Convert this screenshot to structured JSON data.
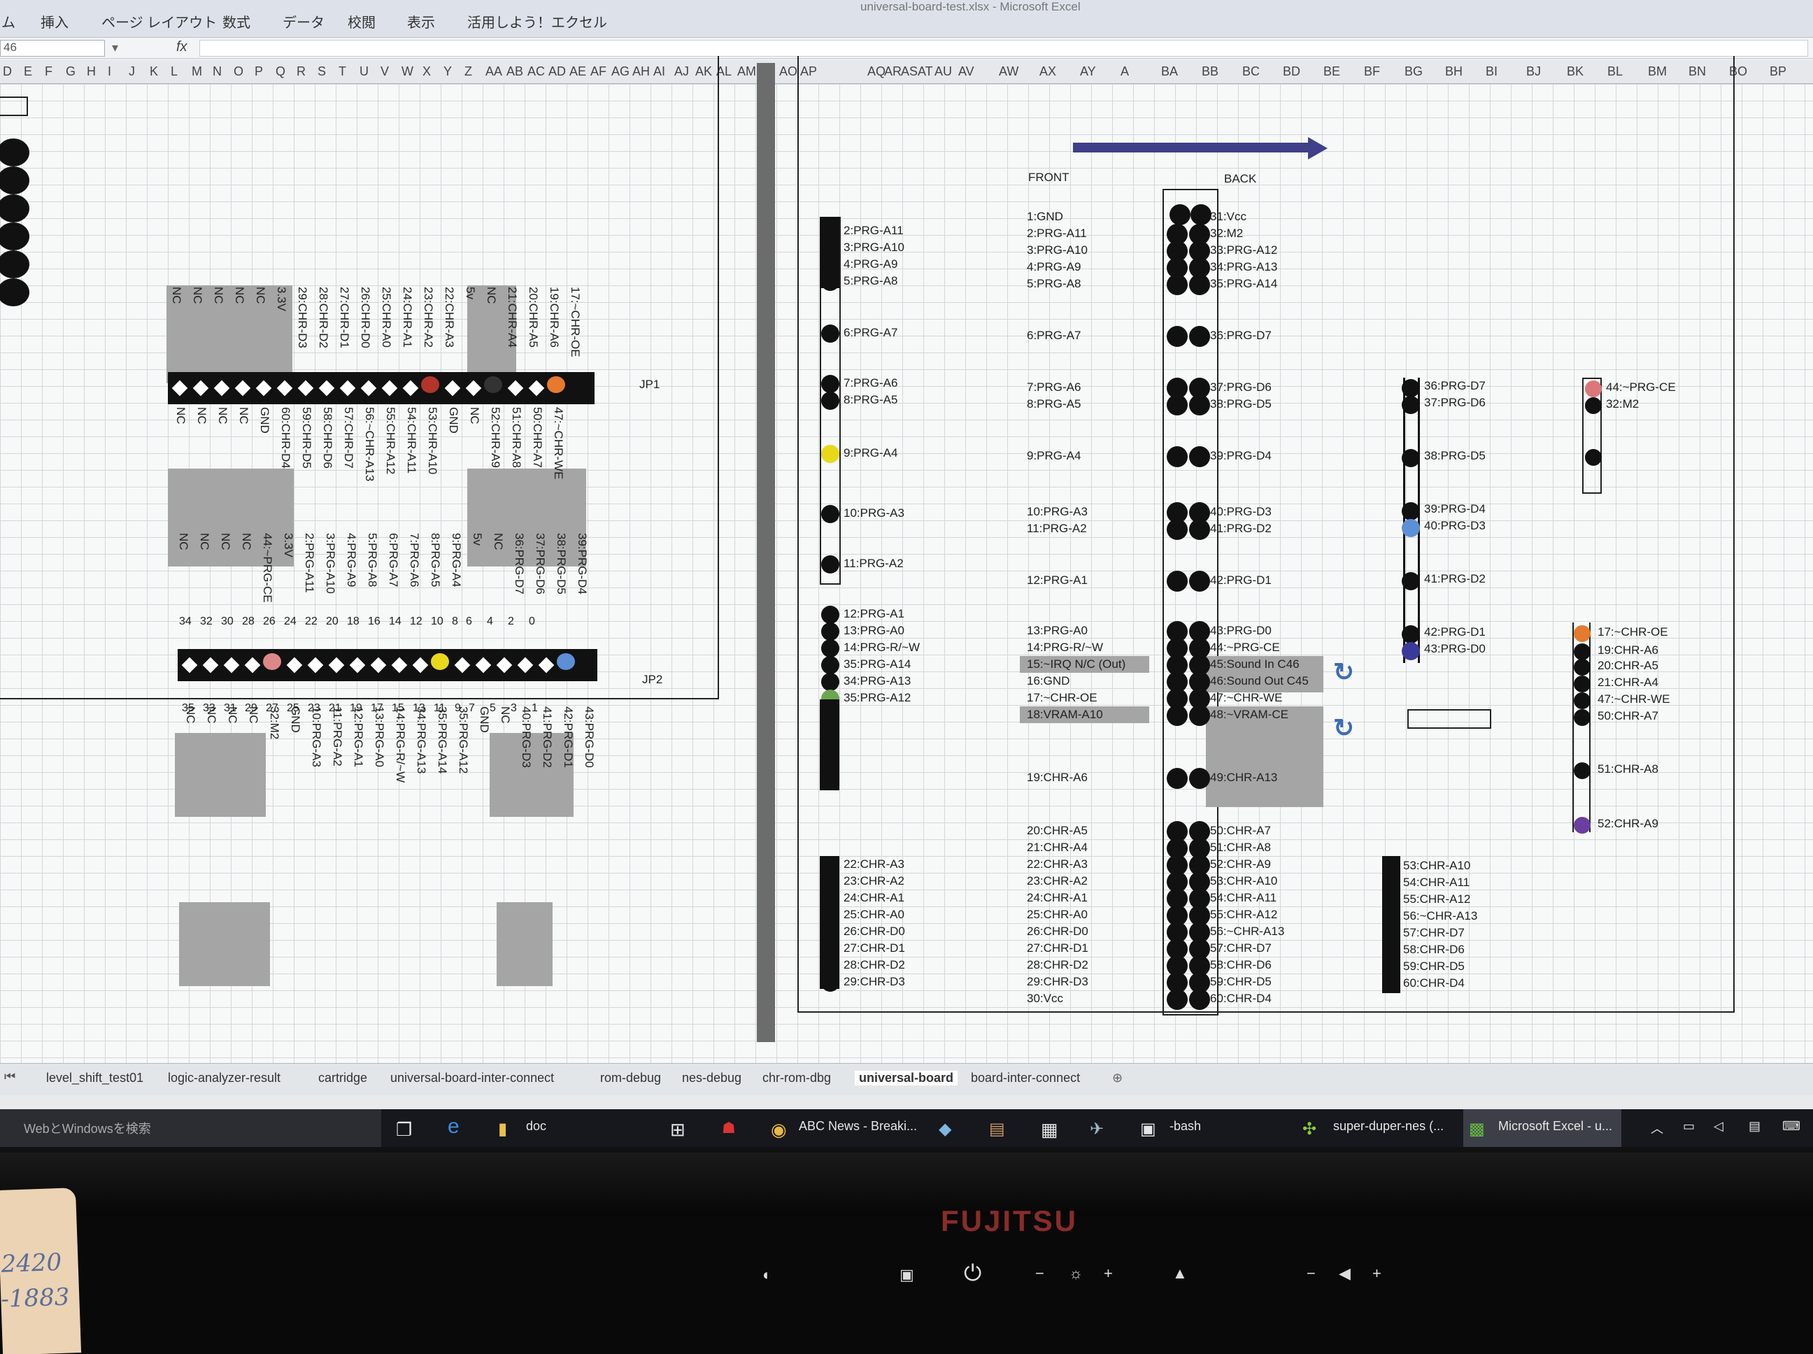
{
  "window": {
    "title": "universal-board-test.xlsx - Microsoft Excel"
  },
  "ribbon_tabs": [
    "ム",
    "挿入",
    "ページ レイアウト",
    "数式",
    "データ",
    "校閲",
    "表示",
    "活用しよう！エクセル"
  ],
  "formula_bar": {
    "name_box": "46",
    "fx": "fx"
  },
  "column_headers": [
    "D",
    "E",
    "F",
    "G",
    "H",
    "I",
    "J",
    "K",
    "L",
    "M",
    "N",
    "O",
    "P",
    "Q",
    "R",
    "S",
    "T",
    "U",
    "V",
    "W",
    "X",
    "Y",
    "Z",
    "AA",
    "AB",
    "AC",
    "AD",
    "AE",
    "AF",
    "AG",
    "AH",
    "AI",
    "AJ",
    "AK",
    "AL",
    "AM",
    "AN",
    "AO",
    "AP",
    "AQ",
    "AR",
    "AS",
    "AT",
    "AU",
    "AV",
    "AW",
    "AX",
    "AY",
    "A",
    "BA",
    "BB",
    "BC",
    "BD",
    "BE",
    "BF",
    "BG",
    "BH",
    "BI",
    "BJ",
    "BK",
    "BL",
    "BM",
    "BN",
    "BO",
    "BP"
  ],
  "left": {
    "jp1_label": "JP1",
    "jp2_label": "JP2",
    "jp1_top": [
      "NC",
      "NC",
      "NC",
      "NC",
      "NC",
      "3.3V",
      "29:CHR-D3",
      "28:CHR-D2",
      "27:CHR-D1",
      "26:CHR-D0",
      "25:CHR-A0",
      "24:CHR-A1",
      "23:CHR-A2",
      "22:CHR-A3",
      "5v",
      "NC",
      "21:CHR-A4",
      "20:CHR-A5",
      "19:CHR-A6",
      "17:~CHR-OE"
    ],
    "jp1_bottom": [
      "NC",
      "NC",
      "NC",
      "NC",
      "GND",
      "60:CHR-D4",
      "59:CHR-D5",
      "58:CHR-D6",
      "57:CHR-D7",
      "56:~CHR-A13",
      "55:CHR-A12",
      "54:CHR-A11",
      "53:CHR-A10",
      "GND",
      "NC",
      "52:CHR-A9",
      "51:CHR-A8",
      "50:CHR-A7",
      "47:~CHR-WE"
    ],
    "jp2_top": [
      "NC",
      "NC",
      "NC",
      "NC",
      "44:~PRG-CE",
      "3.3V",
      "2:PRG-A11",
      "3:PRG-A10",
      "4:PRG-A9",
      "5:PRG-A8",
      "6:PRG-A7",
      "7:PRG-A6",
      "8:PRG-A5",
      "9:PRG-A4",
      "5v",
      "NC",
      "36:PRG-D7",
      "37:PRG-D6",
      "38:PRG-D5",
      "39:PRG-D4"
    ],
    "jp2_top_nums": [
      "34",
      "32",
      "30",
      "28",
      "26",
      "24",
      "22",
      "20",
      "18",
      "16",
      "14",
      "12",
      "10",
      "8",
      "6",
      "4",
      "2",
      "0"
    ],
    "jp2_bottom_nums": [
      "35",
      "33",
      "31",
      "29",
      "27",
      "25",
      "23",
      "21",
      "19",
      "17",
      "15",
      "13",
      "11",
      "9",
      "7",
      "5",
      "3",
      "1"
    ],
    "jp2_bottom": [
      "NC",
      "NC",
      "NC",
      "NC",
      "32:M2",
      "GND",
      "10:PRG-A3",
      "11:PRG-A2",
      "12:PRG-A1",
      "13:PRG-A0",
      "14:PRG-R/~W",
      "34:PRG-A13",
      "35:PRG-A14",
      "35:PRG-A12",
      "GND",
      "NC",
      "40:PRG-D3",
      "41:PRG-D2",
      "42:PRG-D1",
      "43:PRG-D0"
    ]
  },
  "right": {
    "front_label": "FRONT",
    "back_label": "BACK",
    "conn1": [
      "2:PRG-A11",
      "3:PRG-A10",
      "4:PRG-A9",
      "5:PRG-A8",
      "6:PRG-A7",
      "7:PRG-A6",
      "8:PRG-A5",
      "9:PRG-A4",
      "10:PRG-A3",
      "11:PRG-A2",
      "12:PRG-A1",
      "13:PRG-A0",
      "14:PRG-R/~W",
      "35:PRG-A14",
      "34:PRG-A13",
      "35:PRG-A12",
      "22:CHR-A3",
      "23:CHR-A2",
      "24:CHR-A1",
      "25:CHR-A0",
      "26:CHR-D0",
      "27:CHR-D1",
      "28:CHR-D2",
      "29:CHR-D3"
    ],
    "front": [
      "1:GND",
      "2:PRG-A11",
      "3:PRG-A10",
      "4:PRG-A9",
      "5:PRG-A8",
      "6:PRG-A7",
      "7:PRG-A6",
      "8:PRG-A5",
      "9:PRG-A4",
      "10:PRG-A3",
      "11:PRG-A2",
      "12:PRG-A1",
      "13:PRG-A0",
      "14:PRG-R/~W",
      "15:~IRQ N/C (Out)",
      "16:GND",
      "17:~CHR-OE",
      "18:VRAM-A10",
      "19:CHR-A6",
      "20:CHR-A5",
      "21:CHR-A4",
      "22:CHR-A3",
      "23:CHR-A2",
      "24:CHR-A1",
      "25:CHR-A0",
      "26:CHR-D0",
      "27:CHR-D1",
      "28:CHR-D2",
      "29:CHR-D3",
      "30:Vcc"
    ],
    "back": [
      "31:Vcc",
      "32:M2",
      "33:PRG-A12",
      "34:PRG-A13",
      "35:PRG-A14",
      "36:PRG-D7",
      "37:PRG-D6",
      "38:PRG-D5",
      "39:PRG-D4",
      "40:PRG-D3",
      "41:PRG-D2",
      "42:PRG-D1",
      "43:PRG-D0",
      "44:~PRG-CE",
      "45:Sound In C46",
      "46:Sound Out C45",
      "47:~CHR-WE",
      "48:~VRAM-CE",
      "49:CHR-A13",
      "50:CHR-A7",
      "51:CHR-A8",
      "52:CHR-A9",
      "53:CHR-A10",
      "54:CHR-A11",
      "55:CHR-A12",
      "56:~CHR-A13",
      "57:CHR-D7",
      "58:CHR-D6",
      "59:CHR-D5",
      "60:CHR-D4"
    ],
    "conn3_prg": [
      "36:PRG-D7",
      "37:PRG-D6",
      "38:PRG-D5",
      "39:PRG-D4",
      "40:PRG-D3",
      "41:PRG-D2",
      "42:PRG-D1",
      "43:PRG-D0"
    ],
    "conn3_chr": [
      "53:CHR-A10",
      "54:CHR-A11",
      "55:CHR-A12",
      "56:~CHR-A13",
      "57:CHR-D7",
      "58:CHR-D6",
      "59:CHR-D5",
      "60:CHR-D4"
    ],
    "conn4_top": [
      "44:~PRG-CE",
      "32:M2"
    ],
    "conn4_chr": [
      "17:~CHR-OE",
      "19:CHR-A6",
      "20:CHR-A5",
      "21:CHR-A4",
      "47:~CHR-WE",
      "50:CHR-A7",
      "51:CHR-A8",
      "52:CHR-A9"
    ]
  },
  "sheet_tabs": [
    "level_shift_test01",
    "logic-analyzer-result",
    "cartridge",
    "universal-board-inter-connect",
    "rom-debug",
    "nes-debug",
    "chr-rom-dbg",
    "universal-board",
    "board-inter-connect"
  ],
  "taskbar": {
    "search": "WebとWindowsを検索",
    "items": [
      "doc",
      "ABC News - Breaki...",
      "-bash",
      "super-duper-nes (...",
      "Microsoft Excel - u..."
    ]
  },
  "monitor": {
    "brand": "FUJITSU"
  },
  "sticky_note": [
    "2420",
    "-1883"
  ],
  "colors": {
    "accent_orange": "#e67a2e",
    "accent_yellow": "#e9d81a",
    "accent_green": "#6aa84f",
    "accent_blue": "#5c8fd6",
    "accent_purple": "#6b3fa0",
    "accent_red": "#b1352a",
    "arrow_blue": "#3f3f8a"
  }
}
